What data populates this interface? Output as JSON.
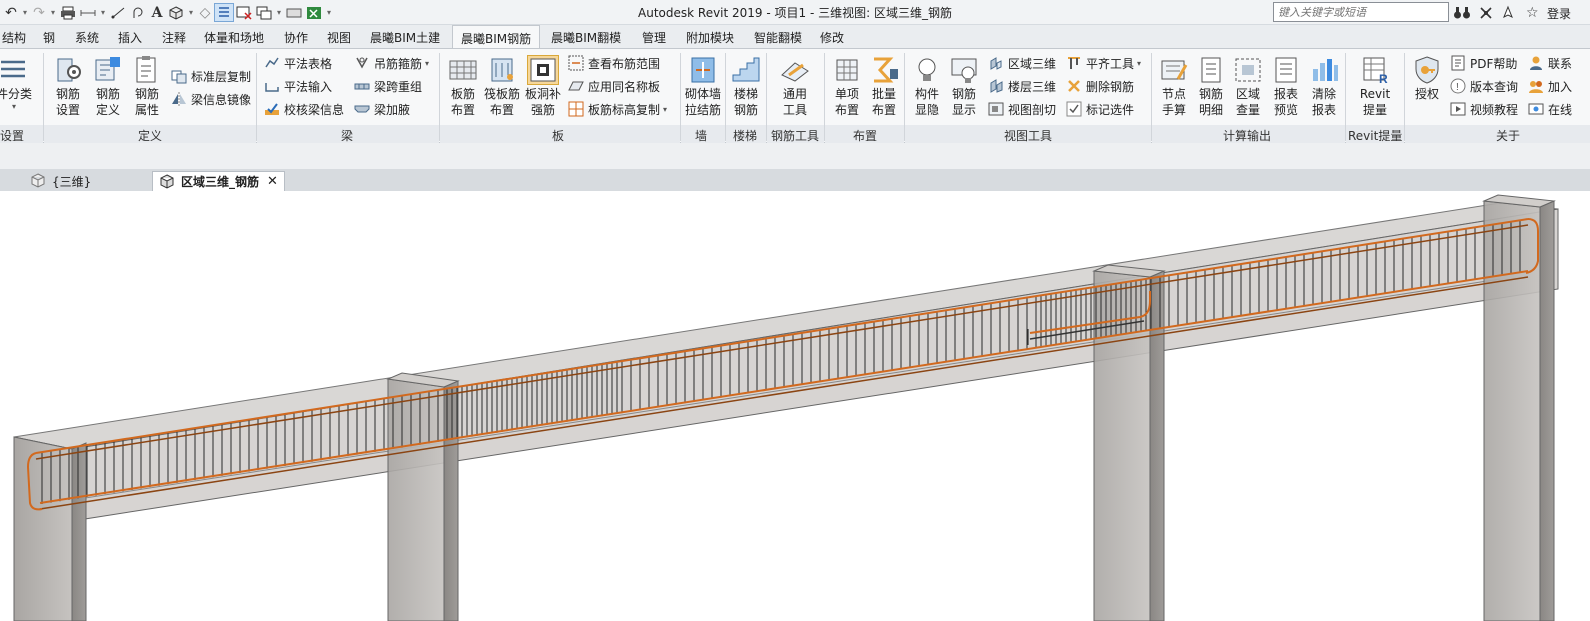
{
  "window": {
    "title": "Autodesk Revit 2019 - 项目1 - 三维视图: 区域三维_钢筋"
  },
  "search": {
    "placeholder": "键入关键字或短语"
  },
  "account": {
    "login_label": "登录"
  },
  "ribbon_tabs": [
    {
      "label": "结构"
    },
    {
      "label": "钢"
    },
    {
      "label": "系统"
    },
    {
      "label": "插入"
    },
    {
      "label": "注释"
    },
    {
      "label": "体量和场地"
    },
    {
      "label": "协作"
    },
    {
      "label": "视图"
    },
    {
      "label": "晨曦BIM土建"
    },
    {
      "label": "晨曦BIM钢筋"
    },
    {
      "label": "晨曦BIM翻模"
    },
    {
      "label": "管理"
    },
    {
      "label": "附加模块"
    },
    {
      "label": "智能翻模"
    },
    {
      "label": "修改"
    }
  ],
  "active_tab": "晨曦BIM钢筋",
  "groups": {
    "settings": {
      "label": "设置",
      "item_classify": "件分类"
    },
    "definition": {
      "label": "定义",
      "rebar_settings": "钢筋\n设置",
      "rebar_define": "钢筋\n定义",
      "rebar_props": "钢筋\n属性",
      "std_floor_copy": "标准层复制",
      "beam_mirror": "梁信息镜像"
    },
    "beam": {
      "label": "梁",
      "flat_table": "平法表格",
      "flat_input": "平法输入",
      "check_beam": "校核梁信息",
      "hanging_stirrup": "吊筋箍筋",
      "span_regroup": "梁跨重组",
      "beam_haunch": "梁加腋"
    },
    "slab": {
      "label": "板",
      "slab_rebar": "板筋\n布置",
      "raft_rebar": "筏板筋\n布置",
      "opening_rebar": "板洞补\n强筋",
      "view_range": "查看布筋范围",
      "apply_same": "应用同名称板",
      "elevation_copy": "板筋标高复制"
    },
    "wall": {
      "label": "墙",
      "masonry_tie": "砌体墙\n拉结筋"
    },
    "stair": {
      "label": "楼梯",
      "stair_rebar": "楼梯\n钢筋"
    },
    "rebar_tools": {
      "label": "钢筋工具",
      "general_tools": "通用\n工具"
    },
    "layout": {
      "label": "布置",
      "single": "单项\n布置",
      "batch": "批量\n布置"
    },
    "view_tools": {
      "label": "视图工具",
      "component_show": "构件\n显隐",
      "rebar_show": "钢筋\n显示",
      "region_3d": "区域三维",
      "floor_3d": "楼层三维",
      "view_section": "视图剖切",
      "align_tool": "平齐工具",
      "delete_rebar": "删除钢筋",
      "mark_select": "标记选件"
    },
    "calc_output": {
      "label": "计算输出",
      "node_manual": "节点\n手算",
      "rebar_detail": "钢筋\n明细",
      "region_qty": "区域\n查量",
      "report_preview": "报表\n预览",
      "clear_report": "清除\n报表"
    },
    "revit_extract": {
      "label": "Revit提量",
      "revit_qty": "Revit\n提量"
    },
    "about": {
      "label": "关于",
      "authorize": "授权",
      "pdf_help": "PDF帮助",
      "version_query": "版本查询",
      "video_tutorial": "视频教程",
      "contact": "联系",
      "join": "加入",
      "online": "在线"
    }
  },
  "document_tabs": [
    {
      "label": "{三维}"
    },
    {
      "label": "区域三维_钢筋"
    }
  ],
  "colors": {
    "concrete": "#b9b6b3",
    "concrete_dark": "#8f8c8a",
    "rebar_longitudinal": "#d2691e",
    "stirrup": "#2a2a2a",
    "active_tab_bg": "#f7f8f9"
  }
}
